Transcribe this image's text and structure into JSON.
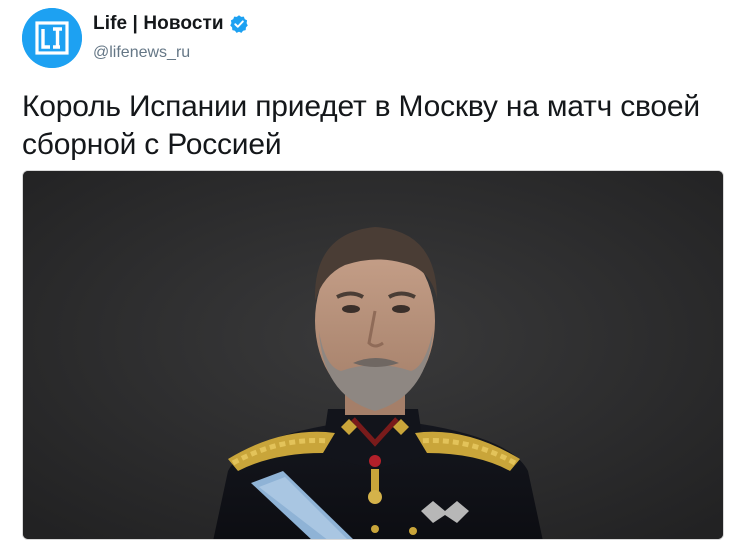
{
  "tweet": {
    "author": {
      "display_name": "Life | Новости",
      "handle": "@lifenews_ru",
      "verified": true,
      "avatar_icon": "life-logo-icon",
      "brand_color": "#1da1f2"
    },
    "text": "Король Испании приедет в Москву на матч своей сборной с Россией",
    "media": {
      "type": "photo",
      "background_color": "#2b2b2c"
    }
  }
}
